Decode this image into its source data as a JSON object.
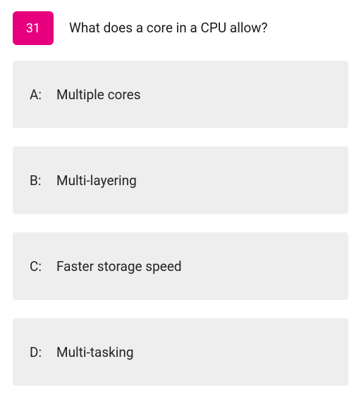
{
  "question": {
    "number": "31",
    "text": "What does a core in a CPU allow?"
  },
  "answers": [
    {
      "letter": "A:",
      "text": "Multiple cores"
    },
    {
      "letter": "B:",
      "text": "Multi-layering"
    },
    {
      "letter": "C:",
      "text": "Faster storage speed"
    },
    {
      "letter": "D:",
      "text": "Multi-tasking"
    }
  ],
  "colors": {
    "accent": "#e6007e",
    "option_bg": "#eeeeee"
  }
}
